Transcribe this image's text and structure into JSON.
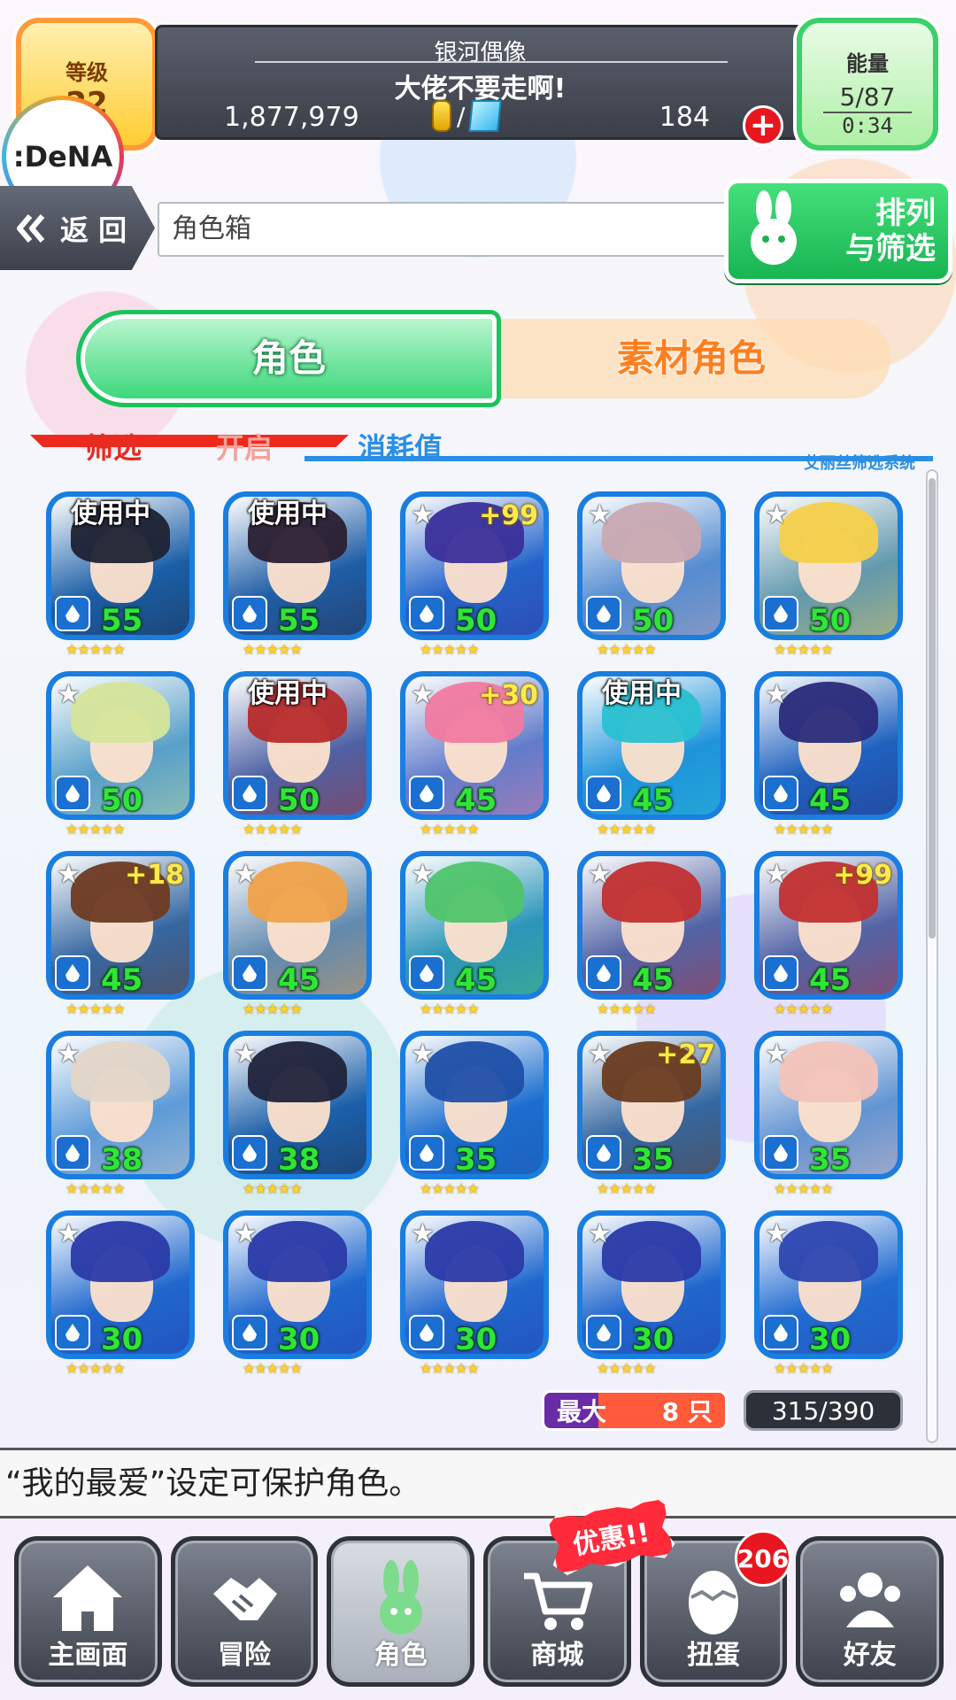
{
  "header": {
    "level_label": "等级",
    "level_value": "22",
    "brand": ":DeNA",
    "player_name": "银河偶像",
    "motto": "大佬不要走啊!",
    "coins": "1,877,979",
    "separator": "/",
    "gems": "184",
    "plus": "+",
    "energy_label": "能量",
    "energy_count": "5/87",
    "energy_timer": "0:34"
  },
  "nav_top": {
    "back_label": "返 回",
    "breadcrumb": "角色箱",
    "sort_label_line1": "排列",
    "sort_label_line2": "与筛选"
  },
  "tabs": [
    {
      "label": "角色",
      "active": true
    },
    {
      "label": "素材角色",
      "active": false
    }
  ],
  "filter": {
    "label": "筛选",
    "value": "开启",
    "sort_by": "消耗值",
    "system": "艾丽丝筛选系统"
  },
  "cards": [
    {
      "cost": "55",
      "badge": "使用中",
      "plus": "",
      "hair": "#1d2233"
    },
    {
      "cost": "55",
      "badge": "使用中",
      "plus": "",
      "hair": "#2b1f33"
    },
    {
      "cost": "50",
      "badge": "",
      "plus": "+99",
      "hair": "#3a2f9a"
    },
    {
      "cost": "50",
      "badge": "",
      "plus": "",
      "hair": "#c9a9b2"
    },
    {
      "cost": "50",
      "badge": "",
      "plus": "",
      "hair": "#f5d04a"
    },
    {
      "cost": "50",
      "badge": "",
      "plus": "",
      "hair": "#d5e59a"
    },
    {
      "cost": "50",
      "badge": "使用中",
      "plus": "",
      "hair": "#b62b2b"
    },
    {
      "cost": "45",
      "badge": "",
      "plus": "+30",
      "hair": "#f17aa0"
    },
    {
      "cost": "45",
      "badge": "使用中",
      "plus": "",
      "hair": "#29c0d1"
    },
    {
      "cost": "45",
      "badge": "",
      "plus": "",
      "hair": "#2a2a7a"
    },
    {
      "cost": "45",
      "badge": "",
      "plus": "+18",
      "hair": "#6e3a22"
    },
    {
      "cost": "45",
      "badge": "",
      "plus": "",
      "hair": "#f0a24a"
    },
    {
      "cost": "45",
      "badge": "",
      "plus": "",
      "hair": "#4fc46a"
    },
    {
      "cost": "45",
      "badge": "",
      "plus": "",
      "hair": "#c23030"
    },
    {
      "cost": "45",
      "badge": "",
      "plus": "+99",
      "hair": "#c23030"
    },
    {
      "cost": "38",
      "badge": "",
      "plus": "",
      "hair": "#e4d6c8"
    },
    {
      "cost": "38",
      "badge": "",
      "plus": "",
      "hair": "#20233a"
    },
    {
      "cost": "35",
      "badge": "",
      "plus": "",
      "hair": "#1f4fa8"
    },
    {
      "cost": "35",
      "badge": "",
      "plus": "+27",
      "hair": "#6a3b20"
    },
    {
      "cost": "35",
      "badge": "",
      "plus": "",
      "hair": "#f3c3b8"
    },
    {
      "cost": "30",
      "badge": "",
      "plus": "",
      "hair": "#2a3aa8"
    },
    {
      "cost": "30",
      "badge": "",
      "plus": "",
      "hair": "#2a3aa8"
    },
    {
      "cost": "30",
      "badge": "",
      "plus": "",
      "hair": "#2a3aa8"
    },
    {
      "cost": "30",
      "badge": "",
      "plus": "",
      "hair": "#2a3aa8"
    },
    {
      "cost": "30",
      "badge": "",
      "plus": "",
      "hair": "#2d46b0"
    }
  ],
  "rarity": "★★★★★",
  "max_badge": {
    "label": "最大",
    "value": "8 只"
  },
  "box_count": "315/390",
  "tip": "“我的最爱”设定可保护角色。",
  "sale_badge": "优惠!!",
  "gacha_count": "206",
  "bottom_nav": [
    {
      "label": "主画面",
      "icon": "home-icon"
    },
    {
      "label": "冒险",
      "icon": "handshake-icon"
    },
    {
      "label": "角色",
      "icon": "rabbit-icon",
      "active": true
    },
    {
      "label": "商城",
      "icon": "cart-icon"
    },
    {
      "label": "扭蛋",
      "icon": "egg-icon"
    },
    {
      "label": "好友",
      "icon": "friends-icon"
    }
  ],
  "colors": {
    "accent_green": "#1bc35c",
    "accent_orange": "#ff7f1f",
    "water_blue": "#1a7de0",
    "cost_green": "#2ee636",
    "filter_red": "#e42d20"
  }
}
